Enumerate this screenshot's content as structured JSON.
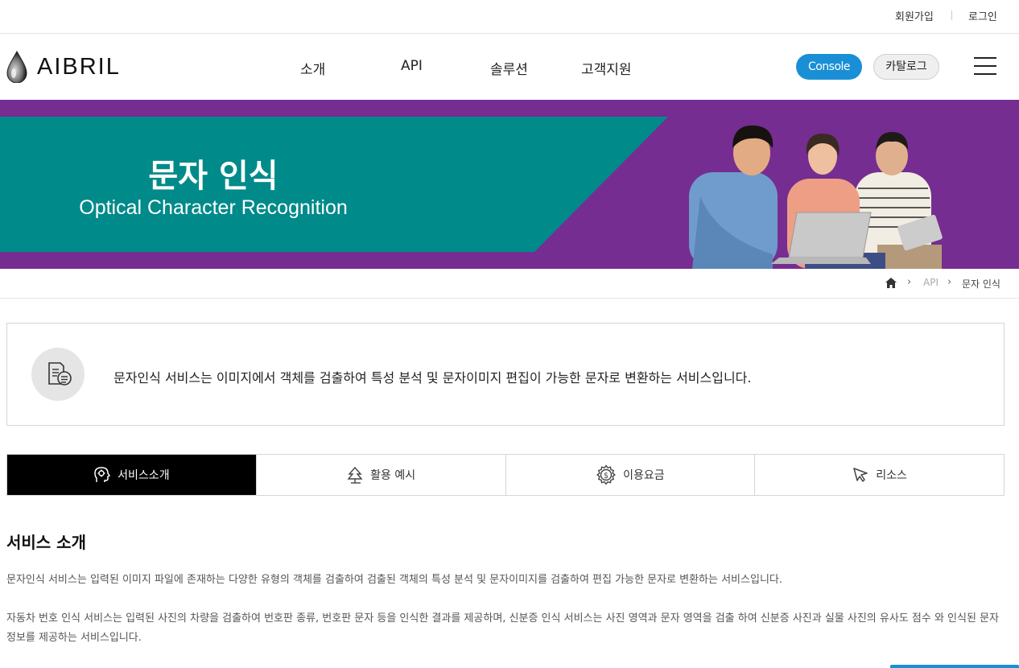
{
  "util_nav": {
    "signup": "회원가입",
    "login": "로그인"
  },
  "header": {
    "logo_text": "AIBRIL",
    "menu": [
      "소개",
      "API",
      "솔루션",
      "고객지원"
    ],
    "console_label": "Console",
    "catalog_label": "카탈로그"
  },
  "banner": {
    "title": "문자 인식",
    "subtitle": "Optical Character Recognition"
  },
  "breadcrumb": [
    "API",
    "문자 인식"
  ],
  "intro": {
    "text": "문자인식 서비스는 이미지에서 객체를 검출하여 특성 분석 및 문자이미지 편집이 가능한 문자로 변환하는 서비스입니다."
  },
  "tabs": [
    {
      "label": "서비스소개",
      "icon": "head-gear-icon",
      "active": true
    },
    {
      "label": "활용 예시",
      "icon": "tree-icon",
      "active": false
    },
    {
      "label": "이용요금",
      "icon": "gear-dollar-icon",
      "active": false
    },
    {
      "label": "리소스",
      "icon": "cursor-icon",
      "active": false
    }
  ],
  "section": {
    "title": "서비스 소개",
    "paragraph1": "문자인식 서비스는 입력된 이미지 파일에 존재하는 다양한 유형의 객체를 검출하여 검출된 객체의 특성 분석 및 문자이미지를 검출하여 편집 가능한 문자로 변환하는 서비스입니다.",
    "paragraph2": "자동차 번호 인식 서비스는 입력된 사진의 차량을 검출하여 번호판 종류, 번호판 문자 등을 인식한 결과를 제공하며, 신분증 인식 서비스는 사진 영역과 문자 영역을 검출 하여 신분증 사진과 실물 사진의 유사도 점수 와 인식된 문자 정보를 제공하는 서비스입니다."
  },
  "colors": {
    "brand_blue": "#1a8fd6",
    "banner_purple": "#762d91",
    "banner_teal": "#008a8a"
  }
}
